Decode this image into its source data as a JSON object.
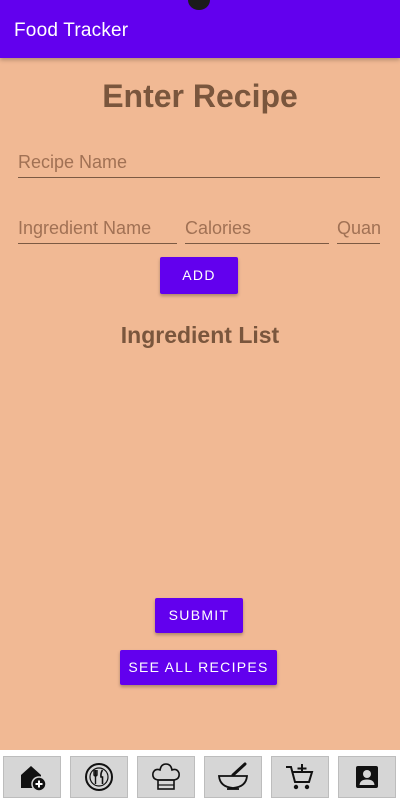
{
  "app": {
    "title": "Food Tracker"
  },
  "form": {
    "page_title": "Enter Recipe",
    "recipe_name_placeholder": "Recipe Name",
    "ingredient_name_placeholder": "Ingredient Name",
    "calories_placeholder": "Calories",
    "quantity_placeholder": "Quantity",
    "add_label": "ADD"
  },
  "ingredients": {
    "title": "Ingredient List",
    "items": []
  },
  "actions": {
    "submit_label": "SUBMIT",
    "see_all_label": "SEE ALL RECIPES"
  },
  "bottom_nav": {
    "items": [
      {
        "icon": "home-add-icon"
      },
      {
        "icon": "plate-utensils-icon"
      },
      {
        "icon": "chef-hat-icon"
      },
      {
        "icon": "mortar-pestle-icon"
      },
      {
        "icon": "add-to-cart-icon"
      },
      {
        "icon": "account-box-icon"
      }
    ]
  },
  "colors": {
    "primary": "#6200ee",
    "background": "#f1b994",
    "heading": "#7a563d",
    "placeholder": "#a17154"
  }
}
